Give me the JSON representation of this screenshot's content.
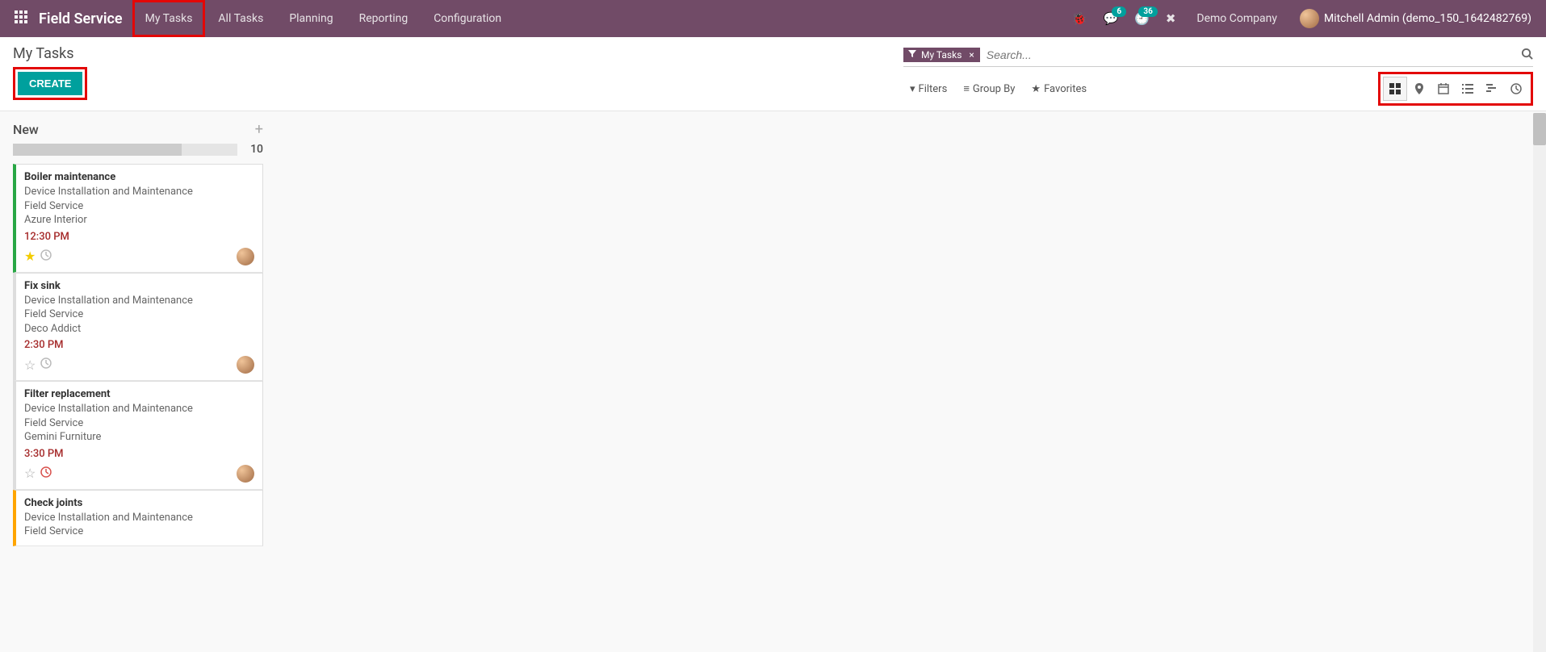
{
  "navbar": {
    "brand": "Field Service",
    "menu": [
      "My Tasks",
      "All Tasks",
      "Planning",
      "Reporting",
      "Configuration"
    ],
    "messages_badge": "6",
    "activities_badge": "36",
    "company": "Demo Company",
    "user": "Mitchell Admin (demo_150_1642482769)"
  },
  "control": {
    "breadcrumb": "My Tasks",
    "create_label": "CREATE",
    "facet_label": "My Tasks",
    "search_placeholder": "Search...",
    "filters_label": "Filters",
    "groupby_label": "Group By",
    "favorites_label": "Favorites"
  },
  "kanban": {
    "column_title": "New",
    "count": "10",
    "cards": [
      {
        "title": "Boiler maintenance",
        "project": "Device Installation and Maintenance",
        "team": "Field Service",
        "customer": "Azure Interior",
        "time": "12:30 PM",
        "starred": true,
        "late": false,
        "accent": "green"
      },
      {
        "title": "Fix sink",
        "project": "Device Installation and Maintenance",
        "team": "Field Service",
        "customer": "Deco Addict",
        "time": "2:30 PM",
        "starred": false,
        "late": false,
        "accent": "none"
      },
      {
        "title": "Filter replacement",
        "project": "Device Installation and Maintenance",
        "team": "Field Service",
        "customer": "Gemini Furniture",
        "time": "3:30 PM",
        "starred": false,
        "late": true,
        "accent": "none"
      },
      {
        "title": "Check joints",
        "project": "Device Installation and Maintenance",
        "team": "Field Service",
        "customer": "",
        "time": "",
        "starred": false,
        "late": false,
        "accent": "orange"
      }
    ]
  }
}
